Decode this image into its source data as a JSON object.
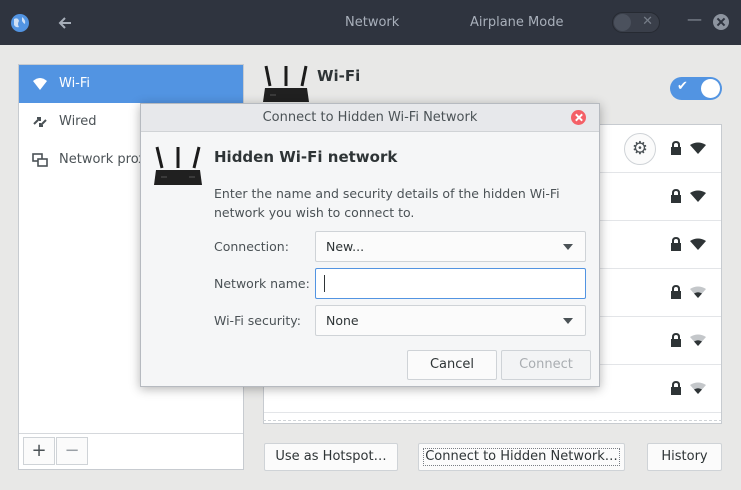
{
  "header": {
    "title": "Network",
    "airplane_mode_label": "Airplane Mode",
    "airplane_mode_on": false
  },
  "sidebar": {
    "items": [
      {
        "label": "Wi-Fi",
        "icon": "wifi-icon",
        "selected": true
      },
      {
        "label": "Wired",
        "icon": "wired-icon",
        "selected": false
      },
      {
        "label": "Network proxy",
        "icon": "network-proxy-icon",
        "selected": false
      }
    ],
    "add_label": "+",
    "remove_label": "−"
  },
  "main": {
    "title": "Wi-Fi",
    "wifi_enabled": true,
    "networks": [
      {
        "name": "",
        "secured": true,
        "signal": "strong",
        "has_settings": true
      },
      {
        "name": "",
        "secured": true,
        "signal": "strong"
      },
      {
        "name": "",
        "secured": true,
        "signal": "strong"
      },
      {
        "name": "",
        "secured": true,
        "signal": "weak"
      },
      {
        "name": "",
        "secured": true,
        "signal": "weak"
      },
      {
        "name": "",
        "secured": true,
        "signal": "weak"
      }
    ],
    "buttons": {
      "hotspot": "Use as Hotspot…",
      "hidden": "Connect to Hidden Network…",
      "history": "History"
    }
  },
  "dialog": {
    "title": "Connect to Hidden Wi-Fi Network",
    "heading": "Hidden Wi-Fi network",
    "description": "Enter the name and security details of the hidden Wi-Fi network you wish to connect to.",
    "connection_label": "Connection:",
    "connection_value": "New...",
    "network_name_label": "Network name:",
    "network_name_value": "",
    "security_label": "Wi-Fi security:",
    "security_value": "None",
    "cancel_label": "Cancel",
    "connect_label": "Connect"
  },
  "colors": {
    "accent": "#5294e2",
    "header_bg": "#2f343f",
    "close_red": "#f46067"
  }
}
